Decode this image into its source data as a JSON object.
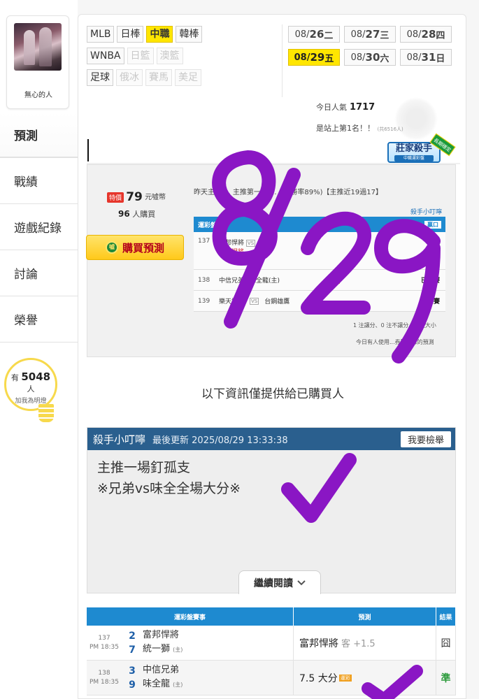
{
  "user": {
    "name": "無心的人"
  },
  "nav": [
    "預測",
    "戰績",
    "遊戲紀錄",
    "討論",
    "榮譽"
  ],
  "supporters": {
    "prefix": "有",
    "count": "5048",
    "suffix": "人",
    "sub": "加我為明燈"
  },
  "sports": {
    "row1": [
      {
        "label": "MLB"
      },
      {
        "label": "日棒"
      },
      {
        "label": "中職",
        "active": true
      },
      {
        "label": "韓棒"
      }
    ],
    "row2": [
      {
        "label": "WNBA"
      },
      {
        "label": "日籃",
        "disabled": true
      },
      {
        "label": "澳籃",
        "disabled": true
      }
    ],
    "row3": [
      {
        "label": "足球"
      },
      {
        "label": "俄冰",
        "disabled": true
      },
      {
        "label": "賽馬",
        "disabled": true
      },
      {
        "label": "美足",
        "disabled": true
      }
    ]
  },
  "dates": {
    "row1": [
      {
        "md": "08/",
        "day": "26",
        "wd": "二"
      },
      {
        "md": "08/",
        "day": "27",
        "wd": "三"
      },
      {
        "md": "08/",
        "day": "28",
        "wd": "四"
      }
    ],
    "row2": [
      {
        "md": "08/",
        "day": "29",
        "wd": "五",
        "active": true
      },
      {
        "md": "08/",
        "day": "30",
        "wd": "六"
      },
      {
        "md": "08/",
        "day": "31",
        "wd": "日"
      }
    ]
  },
  "popularity": {
    "label": "今日人氣",
    "value": "1717"
  },
  "rank": {
    "text": "是站上第1名！！",
    "small": "(共6516人)"
  },
  "badge": {
    "title": "莊家殺手",
    "sub": "中職運彩盤",
    "ribbon": "長期穩定"
  },
  "preview": {
    "tag": "特價",
    "price": "79",
    "price_unit": "元噓幣",
    "buyers": "96",
    "buyers_unit": "人購買",
    "buy_button": "購買預測",
    "headline": "昨天主推 ... 主推第一名 ... (17勝率89%)【主推近19過17】",
    "killer_link": "殺手小叮嚀",
    "table_head": "運彩盤",
    "table_win": "贏口",
    "rows": [
      {
        "no": "137",
        "home": "富邦悍將",
        "away": "(主)",
        "line2": "富邦悍將",
        "status": "開賽"
      },
      {
        "no": "138",
        "home": "中信兄弟",
        "away": "味全龍(主)",
        "ou": "大分",
        "status": "已開賽"
      },
      {
        "no": "139",
        "home": "樂天桃猿",
        "away": "台鋼雄鷹",
        "status": "已開賽"
      }
    ],
    "foot1": "1 注讓分、0 注不讓分、2 注大小",
    "foot2": "今日有人使用...券觀看您的預測"
  },
  "purchasers_note": "以下資訊僅提供給已購買人",
  "tip": {
    "title": "殺手小叮嚀",
    "updated": "最後更新 2025/08/29 13:33:38",
    "report": "我要檢舉",
    "line1": "主推一場釘孤支",
    "line2": "※兄弟vs味全全場大分※",
    "read_more": "繼續閱讀"
  },
  "results": {
    "head": [
      "運彩盤賽事",
      "預測",
      "結果"
    ],
    "rows": [
      {
        "no": "137",
        "time": "PM 18:35",
        "s1": "2",
        "t1": "富邦悍將",
        "s2": "7",
        "t2": "統一獅",
        "home_mark": "(主)",
        "pred": "富邦悍將",
        "pred_extra": "客 +1.5",
        "result": "囧",
        "win": false
      },
      {
        "no": "138",
        "time": "PM 18:35",
        "s1": "3",
        "t1": "中信兄弟",
        "s2": "9",
        "t2": "味全龍",
        "home_mark": "(主)",
        "pred": "7.5 大分",
        "ou": "運彩",
        "result": "準",
        "win": true
      }
    ]
  },
  "overlay": {
    "text": "8/29",
    "color": "#8a16c4"
  }
}
